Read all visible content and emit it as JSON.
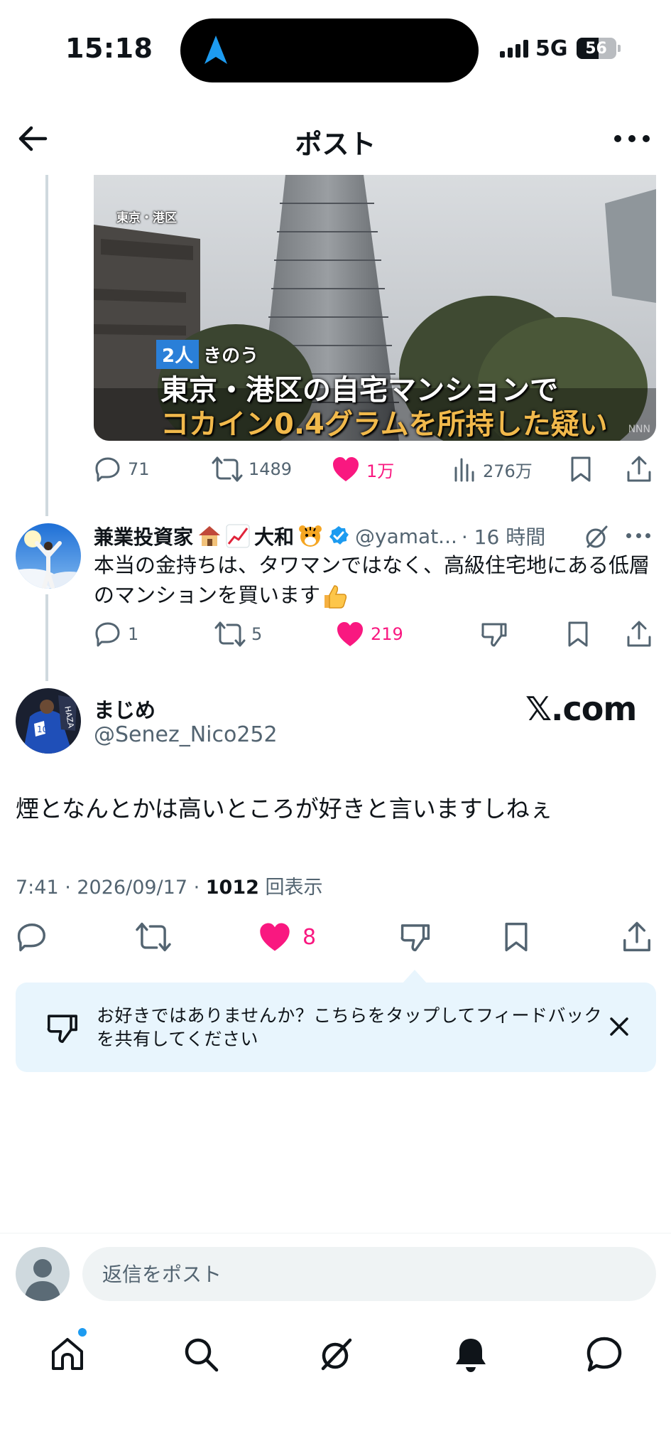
{
  "status_bar": {
    "time": "15:18",
    "network": "5G",
    "battery": "56",
    "battery_level": 0.56
  },
  "header": {
    "title": "ポスト"
  },
  "media": {
    "location_label": "東京・港区",
    "tag_badge": "2人",
    "tag_text": "きのう",
    "caption_line1": "東京・港区の自宅マンションで",
    "caption_line2": "コカイン0.4グラムを所持した疑い",
    "watermark": "NNN"
  },
  "parent_actions": {
    "replies": "71",
    "reposts": "1489",
    "likes": "1万",
    "views": "276万"
  },
  "reply": {
    "name_part1": "兼業投資家",
    "name_part2": "大和",
    "handle": "@yamat...",
    "time": "· 16 時間",
    "text": "本当の金持ちは、タワマンではなく、高級住宅地にある低層のマンションを買います",
    "replies": "1",
    "reposts": "5",
    "likes": "219"
  },
  "main_tweet": {
    "name": "まじめ",
    "handle": "@Senez_Nico252",
    "logo_text": "𝕏.com",
    "text": "煙となんとかは高いところが好きと言いますしねぇ",
    "meta_prefix": "7:41 · 2026/09/17 · ",
    "views_count": "1012",
    "views_suffix": " 回表示",
    "likes": "8"
  },
  "feedback": {
    "text": "お好きではありませんか？こちらをタップしてフィードバックを共有してください"
  },
  "compose": {
    "placeholder": "返信をポスト"
  },
  "colors": {
    "like": "#f91880",
    "accent": "#1d9bf0",
    "muted": "#536471",
    "text": "#0f1419",
    "callout_bg": "#e8f5fd"
  },
  "tabs": [
    "home-icon",
    "search-icon",
    "grok-icon",
    "notifications-icon",
    "messages-icon"
  ]
}
